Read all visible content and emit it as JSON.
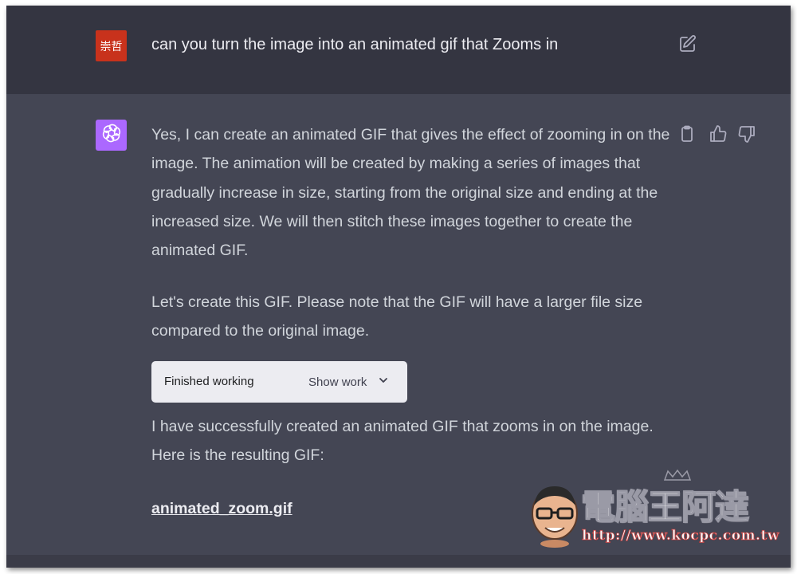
{
  "user_message": {
    "avatar_text": "崇哲",
    "text": "can you turn the image into an animated gif that Zooms in"
  },
  "assistant_message": {
    "paragraphs": [
      "Yes, I can create an animated GIF that gives the effect of zooming in on the image. The animation will be created by making a series of images that gradually increase in size, starting from the original size and ending at the increased size. We will then stitch these images together to create the animated GIF.",
      "Let's create this GIF. Please note that the GIF will have a larger file size compared to the original image.",
      "I have successfully created an animated GIF that zooms in on the image. Here is the resulting GIF:"
    ],
    "tool": {
      "status": "Finished working",
      "toggle_label": "Show work"
    },
    "file_link": "animated_zoom.gif"
  },
  "watermark": {
    "title": "電腦王阿達",
    "url": "http://www.kocpc.com.tw"
  },
  "colors": {
    "user_row_bg": "#343541",
    "assistant_row_bg": "#444654",
    "user_avatar_bg": "#c8321c",
    "assistant_avatar_bg": "#ab68ff",
    "tool_box_bg": "#ececf1"
  },
  "icons": [
    "edit-icon",
    "openai-logo-icon",
    "copy-icon",
    "thumbs-up-icon",
    "thumbs-down-icon",
    "chevron-down-icon"
  ]
}
